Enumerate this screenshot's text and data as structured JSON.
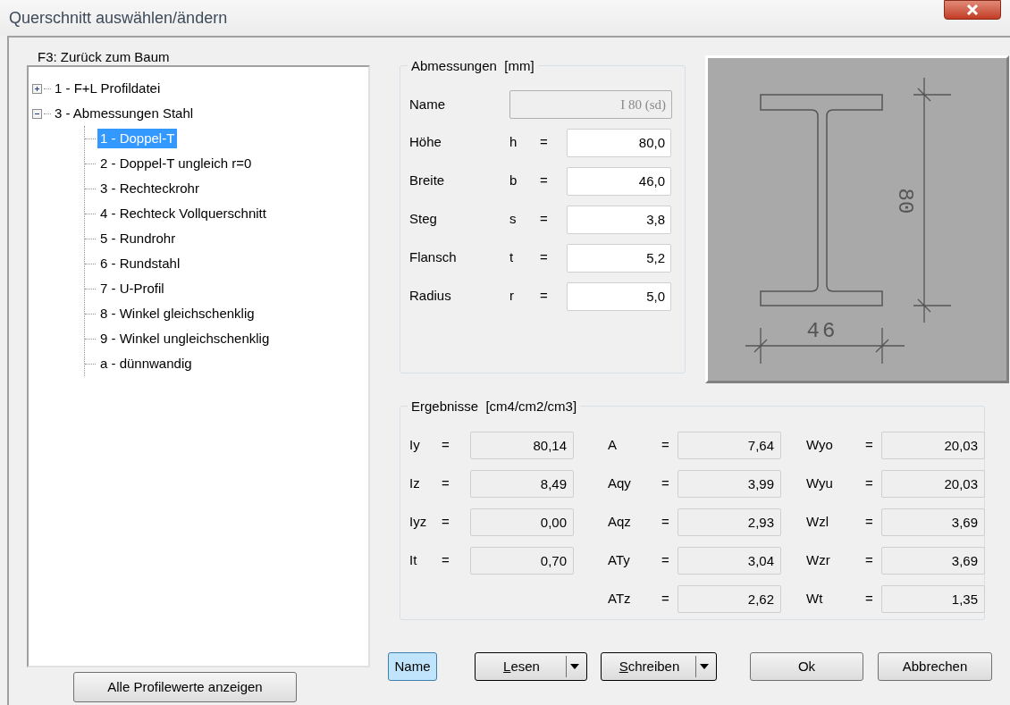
{
  "window": {
    "title": "Querschnitt auswählen/ändern"
  },
  "tree": {
    "label": "F3: Zurück zum Baum",
    "items": [
      {
        "label": "1 - F+L Profildatei",
        "expanded": false,
        "selected": false
      },
      {
        "label": "3 - Abmessungen Stahl",
        "expanded": true,
        "selected": false,
        "children": [
          {
            "label": "1 - Doppel-T",
            "selected": true
          },
          {
            "label": "2 - Doppel-T ungleich r=0",
            "selected": false
          },
          {
            "label": "3 - Rechteckrohr",
            "selected": false
          },
          {
            "label": "4 - Rechteck Vollquerschnitt",
            "selected": false
          },
          {
            "label": "5 - Rundrohr",
            "selected": false
          },
          {
            "label": "6 - Rundstahl",
            "selected": false
          },
          {
            "label": "7 - U-Profil",
            "selected": false
          },
          {
            "label": "8 - Winkel gleichschenklig",
            "selected": false
          },
          {
            "label": "9 - Winkel ungleichschenklig",
            "selected": false
          },
          {
            "label": "a - dünnwandig",
            "selected": false
          }
        ]
      }
    ]
  },
  "show_all_button": "Alle Profilewerte anzeigen",
  "dimensions": {
    "title": "Abmessungen  [mm]",
    "name": {
      "label": "Name",
      "value": "I 80 (sd)",
      "disabled": true
    },
    "fields": [
      {
        "label": "Höhe",
        "symbol": "h",
        "equals": "=",
        "value": "80,0"
      },
      {
        "label": "Breite",
        "symbol": "b",
        "equals": "=",
        "value": "46,0"
      },
      {
        "label": "Steg",
        "symbol": "s",
        "equals": "=",
        "value": "3,8"
      },
      {
        "label": "Flansch",
        "symbol": "t",
        "equals": "=",
        "value": "5,2"
      },
      {
        "label": "Radius",
        "symbol": "r",
        "equals": "=",
        "value": "5,0"
      }
    ]
  },
  "drawing": {
    "width_label": "46",
    "height_label": "80"
  },
  "results": {
    "title": "Ergebnisse  [cm4/cm2/cm3]",
    "columns": [
      [
        {
          "label": "Iy",
          "equals": "=",
          "value": "80,14"
        },
        {
          "label": "Iz",
          "equals": "=",
          "value": "8,49"
        },
        {
          "label": "Iyz",
          "equals": "=",
          "value": "0,00"
        },
        {
          "label": "It",
          "equals": "=",
          "value": "0,70"
        }
      ],
      [
        {
          "label": "A",
          "equals": "=",
          "value": "7,64"
        },
        {
          "label": "Aqy",
          "equals": "=",
          "value": "3,99"
        },
        {
          "label": "Aqz",
          "equals": "=",
          "value": "2,93"
        },
        {
          "label": "ATy",
          "equals": "=",
          "value": "3,04"
        },
        {
          "label": "ATz",
          "equals": "=",
          "value": "2,62"
        }
      ],
      [
        {
          "label": "Wyo",
          "equals": "=",
          "value": "20,03"
        },
        {
          "label": "Wyu",
          "equals": "=",
          "value": "20,03"
        },
        {
          "label": "Wzl",
          "equals": "=",
          "value": "3,69"
        },
        {
          "label": "Wzr",
          "equals": "=",
          "value": "3,69"
        },
        {
          "label": "Wt",
          "equals": "=",
          "value": "1,35"
        }
      ]
    ]
  },
  "buttons": [
    {
      "label": "Name",
      "kind": "toggle",
      "on": true
    },
    {
      "label": "Lesen",
      "kind": "split",
      "underline_first": true
    },
    {
      "label": "Schreiben",
      "kind": "split",
      "underline_first": true
    },
    {
      "label": "Ok",
      "kind": "push"
    },
    {
      "label": "Abbrechen",
      "kind": "push"
    }
  ]
}
